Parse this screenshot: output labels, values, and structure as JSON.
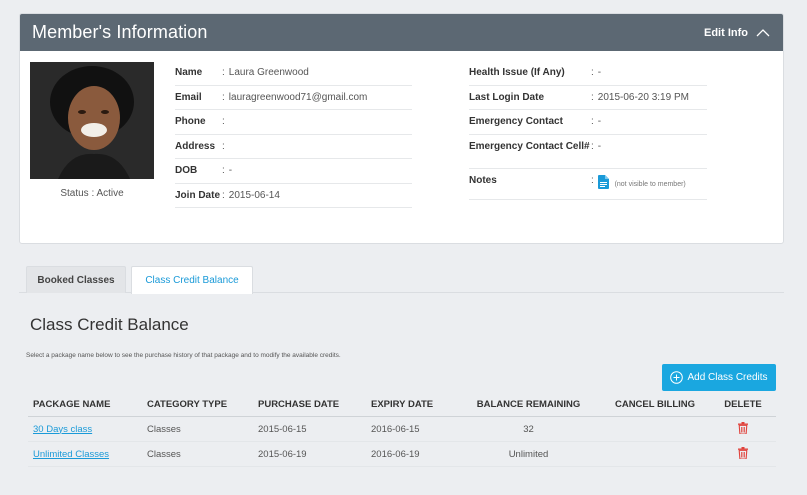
{
  "member": {
    "title": "Member's Information",
    "edit_label": "Edit Info",
    "status": "Status : Active",
    "left_fields": [
      {
        "label": "Name",
        "value": "Laura Greenwood"
      },
      {
        "label": "Email",
        "value": "lauragreenwood71@gmail.com"
      },
      {
        "label": "Phone",
        "value": ""
      },
      {
        "label": "Address",
        "value": ""
      },
      {
        "label": "DOB",
        "value": "-"
      },
      {
        "label": "Join Date",
        "value": "2015-06-14"
      }
    ],
    "right_fields": [
      {
        "label": "Health Issue (If Any)",
        "value": "-"
      },
      {
        "label": "Last Login Date",
        "value": "2015-06-20 3:19 PM"
      },
      {
        "label": "Emergency Contact",
        "value": "-"
      },
      {
        "label": "Emergency Contact Cell#",
        "value": "-"
      },
      {
        "label": "Notes",
        "value": "(not visible to member)"
      }
    ],
    "colon": ":"
  },
  "tabs": {
    "booked": "Booked Classes",
    "credit": "Class Credit Balance"
  },
  "credit": {
    "title": "Class Credit Balance",
    "hint": "Select a package name below to see the purchase history of that package and to modify the available credits.",
    "add_button": "Add Class Credits",
    "columns": [
      "PACKAGE NAME",
      "CATEGORY TYPE",
      "PURCHASE DATE",
      "EXPIRY DATE",
      "BALANCE REMAINING",
      "CANCEL BILLING",
      "DELETE"
    ],
    "rows": [
      {
        "package": "30 Days class",
        "category": "Classes",
        "purchase": "2015-06-15",
        "expiry": "2016-06-15",
        "balance": "32",
        "cancel": ""
      },
      {
        "package": "Unlimited Classes",
        "category": "Classes",
        "purchase": "2015-06-19",
        "expiry": "2016-06-19",
        "balance": "Unlimited",
        "cancel": ""
      }
    ]
  },
  "colors": {
    "header_bg": "#5c6873",
    "accent_blue": "#1aa7e0",
    "link_blue": "#1a9ad8",
    "delete_red": "#e0413b"
  },
  "icons": {
    "edit_toggle": "chevron-up-icon",
    "notes": "document-icon",
    "add": "plus-circle-icon",
    "delete": "trash-icon"
  }
}
